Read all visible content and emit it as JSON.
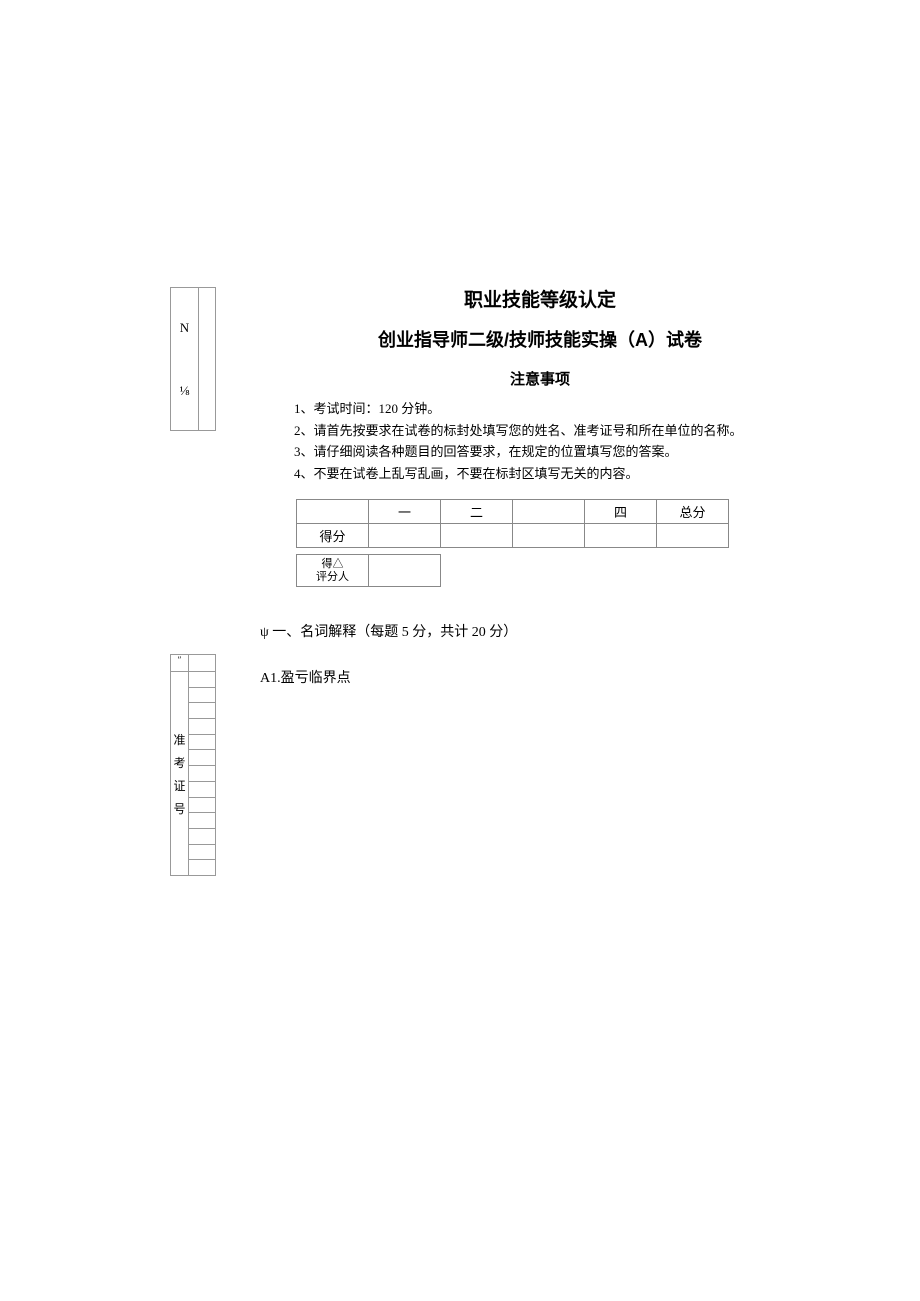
{
  "left_box_1": {
    "n": "N",
    "frac": "⅛"
  },
  "header": {
    "title1": "职业技能等级认定",
    "title2": "创业指导师二级/技师技能实操（A）试卷",
    "notice_heading": "注意事项"
  },
  "notices": [
    "1、考试时间：120 分钟。",
    "2、请首先按要求在试卷的标封处填写您的姓名、准考证号和所在单位的名称。",
    "3、请仔细阅读各种题目的回答要求，在规定的位置填写您的答案。",
    "4、不要在试卷上乱写乱画，不要在标封区填写无关的内容。"
  ],
  "score_table": {
    "cols": [
      "",
      "一",
      "二",
      "",
      "四",
      "总分"
    ],
    "row_label": "得分"
  },
  "small_table": {
    "label_line1": "得△",
    "label_line2": "评分人"
  },
  "section1": {
    "heading": "ψ 一、名词解释（每题 5 分，共计 20 分）",
    "item": "A1.盈亏临界点"
  },
  "left_box_2": {
    "label_chars": [
      "准",
      "考",
      "证",
      "号"
    ],
    "top_char": "″",
    "line_count": 13
  }
}
